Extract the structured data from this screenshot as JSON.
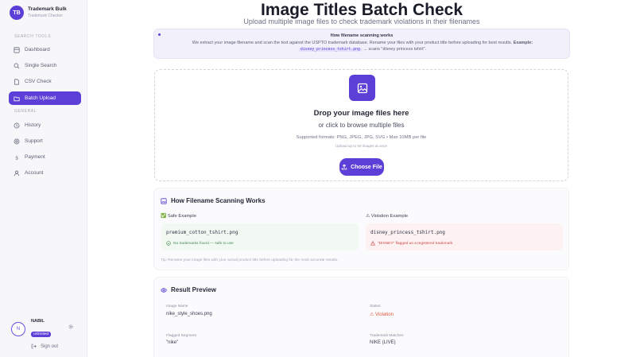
{
  "brand": {
    "initials": "TB",
    "title": "Trademark Bulk",
    "subtitle": "Trademark Checker"
  },
  "sidebar": {
    "search_tools_label": "SEARCH TOOLS",
    "search_tools": [
      {
        "label": "Dashboard",
        "icon": "dashboard-icon"
      },
      {
        "label": "Single Search",
        "icon": "search-icon"
      },
      {
        "label": "CSV Check",
        "icon": "document-icon"
      },
      {
        "label": "Batch Upload",
        "icon": "folder-icon",
        "active": true
      }
    ],
    "general_label": "GENERAL",
    "general": [
      {
        "label": "History",
        "icon": "history-icon"
      },
      {
        "label": "Support",
        "icon": "support-icon"
      },
      {
        "label": "Payment",
        "icon": "dollar-icon"
      },
      {
        "label": "Account",
        "icon": "user-icon"
      }
    ]
  },
  "user": {
    "initial": "N",
    "name": "NABIL",
    "plan": "unlimited",
    "signout": "Sign out"
  },
  "header": {
    "title": "Image Titles Batch Check",
    "subtitle": "Upload multiple image files to check trademark violations in their filenames"
  },
  "info": {
    "title": "How filename scanning works",
    "body": "We extract your image filename and scan the text against the USPTO trademark database. Rename your files with your product title before uploading for best results.",
    "example_label": "Example:",
    "example_file": "disney_princess_tshirt.png",
    "example_result": "→ scans \"disney princess tshirt\"."
  },
  "dropzone": {
    "title": "Drop your image files here",
    "subtitle": "or click to browse multiple files",
    "formats": "Supported formats: PNG, JPEG, JPG, SVG • Max 10MB per file",
    "limit": "Upload up to 50 images at once",
    "button": "Choose File"
  },
  "scanning": {
    "title": "How Filename Scanning Works",
    "safe_label": "✅ Safe Example",
    "safe_file": "premium_cotton_tshirt.png",
    "safe_note": "No trademarks found — safe to use",
    "violation_label": "⚠ Violation Example",
    "violation_file": "disney_princess_tshirt.png",
    "violation_note": "\"DISNEY\" flagged as a registered trademark",
    "tip": "Tip: Rename your image files with your actual product title before uploading for the most accurate results."
  },
  "preview": {
    "title": "Result Preview",
    "image_name_label": "Image Name",
    "image_name": "nike_style_shoes.png",
    "status_label": "Status",
    "status": "⚠ Violation",
    "flagged_label": "Flagged Segment",
    "flagged": "\"nike\"",
    "matches_label": "Trademark Matches",
    "matches": "NIKE (LIVE)"
  },
  "colors": {
    "accent": "#5b3fd6",
    "safe": "#4b8a57",
    "violation": "#e0593f"
  }
}
